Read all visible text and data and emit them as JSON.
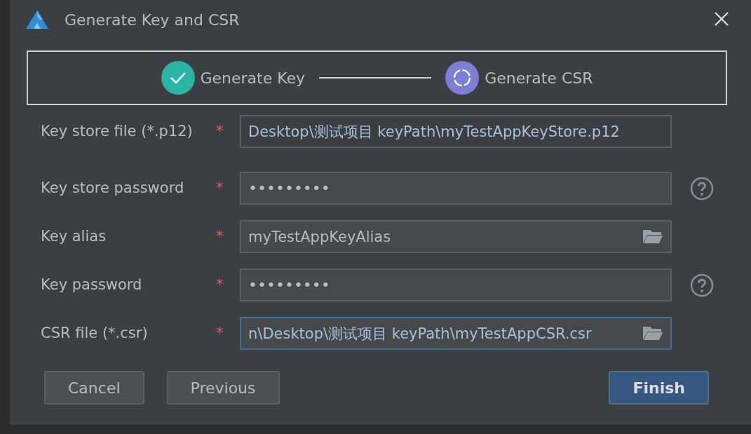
{
  "window": {
    "title": "Generate Key and CSR"
  },
  "steps": [
    {
      "label": "Generate Key",
      "completed": true
    },
    {
      "label": "Generate CSR",
      "completed": false
    }
  ],
  "fields": [
    {
      "label": "Key store file (*.p12)",
      "required": "*",
      "kind": "text",
      "value": "Desktop\\测试项目 keyPath\\myTestAppKeyStore.p12",
      "browse": false,
      "help": false,
      "focused": false
    },
    {
      "label": "Key store password",
      "required": "*",
      "kind": "password",
      "value": "•••••••••",
      "browse": false,
      "help": true,
      "focused": false
    },
    {
      "label": "Key alias",
      "required": "*",
      "kind": "text",
      "value": "myTestAppKeyAlias",
      "browse": true,
      "help": false,
      "focused": false
    },
    {
      "label": "Key password",
      "required": "*",
      "kind": "password",
      "value": "•••••••••",
      "browse": false,
      "help": true,
      "focused": false
    },
    {
      "label": "CSR file (*.csr)",
      "required": "*",
      "kind": "text",
      "value": "n\\Desktop\\测试项目 keyPath\\myTestAppCSR.csr",
      "browse": true,
      "help": false,
      "focused": true
    }
  ],
  "buttons": [
    {
      "label": "Cancel",
      "primary": false
    },
    {
      "label": "Previous",
      "primary": false
    },
    {
      "label": "Finish",
      "primary": true
    }
  ]
}
